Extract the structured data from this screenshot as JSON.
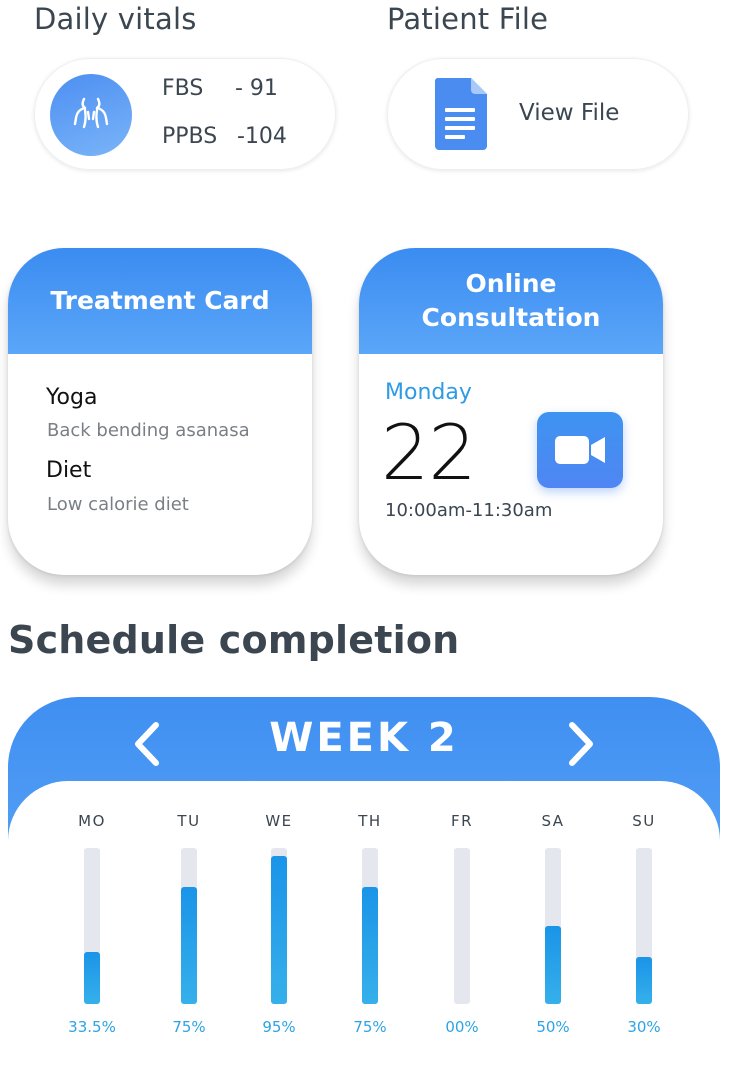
{
  "vitals": {
    "title": "Daily vitals",
    "fbs_label": "FBS",
    "fbs_value": "- 91",
    "ppbs_label": "PPBS",
    "ppbs_value": "-104"
  },
  "patient_file": {
    "title": "Patient File",
    "action_label": "View File",
    "icon": "document-icon"
  },
  "treatment_card": {
    "title": "Treatment Card",
    "items": [
      {
        "name": "Yoga",
        "detail": "Back bending  asanasa"
      },
      {
        "name": "Diet",
        "detail": "Low calorie diet"
      }
    ]
  },
  "consultation": {
    "title_line1": "Online",
    "title_line2": "Consultation",
    "day": "Monday",
    "date": "22",
    "time": "10:00am-11:30am",
    "icon": "video-camera-icon"
  },
  "schedule": {
    "title": "Schedule completion",
    "week_label": "WEEK 2",
    "prev_icon": "chevron-left-icon",
    "next_icon": "chevron-right-icon",
    "days": [
      {
        "label": "MO",
        "value": 0.335,
        "pct_text": "33.5%"
      },
      {
        "label": "TU",
        "value": 0.75,
        "pct_text": "75%"
      },
      {
        "label": "WE",
        "value": 0.95,
        "pct_text": "95%"
      },
      {
        "label": "TH",
        "value": 0.75,
        "pct_text": "75%"
      },
      {
        "label": "FR",
        "value": 0.0,
        "pct_text": "00%"
      },
      {
        "label": "SA",
        "value": 0.5,
        "pct_text": "50%"
      },
      {
        "label": "SU",
        "value": 0.3,
        "pct_text": "30%"
      }
    ]
  },
  "colors": {
    "accent_blue": "#3b8cf1",
    "bar_fill": "#1a94e8",
    "bar_track": "#e4e8ee",
    "text_dark": "#3b4651"
  }
}
